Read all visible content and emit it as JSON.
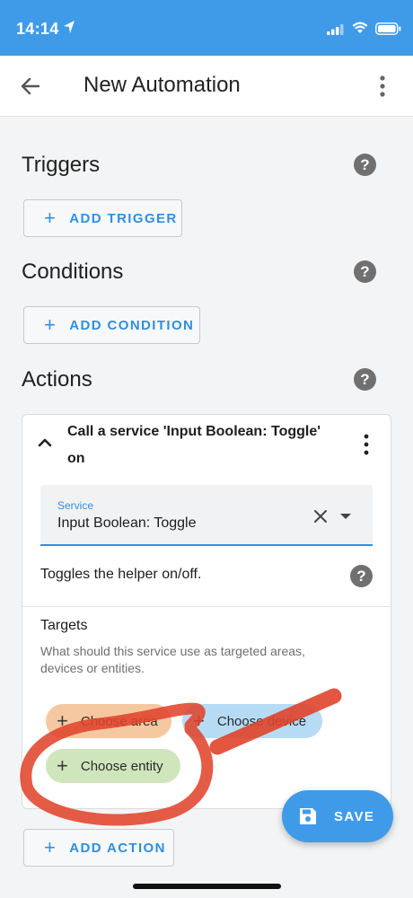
{
  "status_bar": {
    "time": "14:14"
  },
  "app_bar": {
    "title": "New Automation"
  },
  "triggers": {
    "title": "Triggers",
    "add_label": "ADD TRIGGER"
  },
  "conditions": {
    "title": "Conditions",
    "add_label": "ADD CONDITION"
  },
  "actions": {
    "title": "Actions",
    "card": {
      "title": "Call a service 'Input Boolean: Toggle' on",
      "service_label": "Service",
      "service_value": "Input Boolean: Toggle",
      "description": "Toggles the helper on/off.",
      "targets_title": "Targets",
      "targets_help": "What should this service use as targeted areas, devices or entities.",
      "chips": {
        "area": "Choose area",
        "device": "Choose device",
        "entity": "Choose entity"
      }
    },
    "add_label": "ADD ACTION"
  },
  "save_label": "SAVE",
  "colors": {
    "primary": "#3f9be8",
    "accent_text": "#2f8fe0",
    "annotation": "#e0442c"
  }
}
